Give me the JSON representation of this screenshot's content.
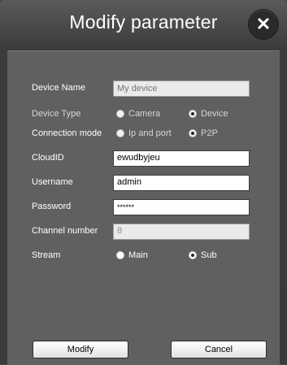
{
  "dialog": {
    "title": "Modify parameter",
    "close_glyph": "✕"
  },
  "form": {
    "device_name": {
      "label": "Device Name",
      "placeholder": "My device",
      "value": ""
    },
    "device_type": {
      "label": "Device Type",
      "options": [
        "Camera",
        "Device"
      ],
      "selected": "Device"
    },
    "connection_mode": {
      "label": "Connection mode",
      "options": [
        "Ip and port",
        "P2P"
      ],
      "selected": "P2P"
    },
    "cloud_id": {
      "label": "CloudID",
      "value": "ewudbyjeu"
    },
    "username": {
      "label": "Username",
      "value": "admin"
    },
    "password": {
      "label": "Password",
      "value": "******"
    },
    "channel_number": {
      "label": "Channel number",
      "value": "8"
    },
    "stream": {
      "label": "Stream",
      "options": [
        "Main",
        "Sub"
      ],
      "selected": "Sub"
    }
  },
  "buttons": {
    "modify": "Modify",
    "cancel": "Cancel"
  },
  "icons": {
    "close": "close-icon"
  },
  "colors": {
    "background": "#3c3c3c",
    "panel": "#606060",
    "text": "#ffffff"
  }
}
